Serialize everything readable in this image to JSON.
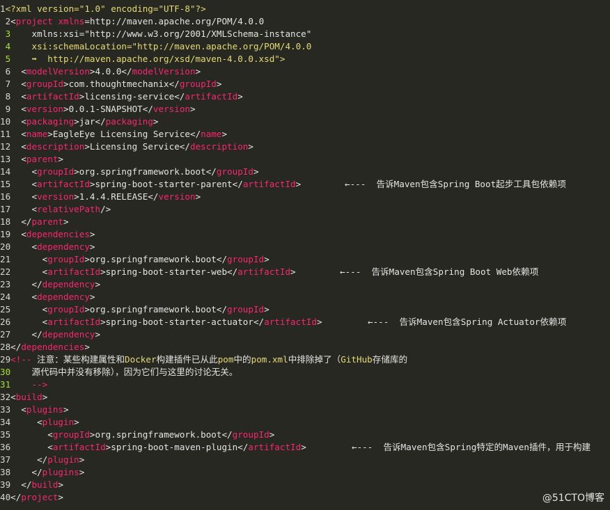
{
  "colors": {
    "background": "#272822",
    "text": "#e4e4e4",
    "tag": "#f92672",
    "string": "#e6db74",
    "attribute": "#a6e22e",
    "comment": "#f92672",
    "line_number_highlight": "#a6e22e"
  },
  "code": {
    "lines": [
      {
        "n": "1",
        "tokens": [
          {
            "t": "<?xml version=\"1.0\" encoding=\"UTF-8\"?>",
            "c": "string"
          }
        ]
      },
      {
        "n": " 2",
        "tokens": [
          {
            "t": "<",
            "c": "text"
          },
          {
            "t": "project",
            "c": "tag"
          },
          {
            "t": " ",
            "c": "text"
          },
          {
            "t": "xmlns",
            "c": "tag"
          },
          {
            "t": "=http://maven.apache.org/POM/4.0.0",
            "c": "text"
          }
        ]
      },
      {
        "n": " 3",
        "hl": true,
        "tokens": [
          {
            "t": "    xmlns:xsi=\"http://www.w3.org/2001/XMLSchema-instance\"",
            "c": "text"
          }
        ]
      },
      {
        "n": " 4",
        "hl": true,
        "tokens": [
          {
            "t": "    xsi:schemaLocation=\"http://maven.apache.org/POM/4.0.0",
            "c": "string"
          }
        ]
      },
      {
        "n": " 5",
        "hl": true,
        "tokens": [
          {
            "t": "    ➡  http://maven.apache.org/xsd/maven-4.0.0.xsd\">",
            "c": "string"
          }
        ]
      },
      {
        "n": " 6",
        "tokens": [
          {
            "t": "  <",
            "c": "text"
          },
          {
            "t": "modelVersion",
            "c": "tag"
          },
          {
            "t": ">4.0.0</",
            "c": "text"
          },
          {
            "t": "modelVersion",
            "c": "tag"
          },
          {
            "t": ">",
            "c": "text"
          }
        ]
      },
      {
        "n": " 7",
        "tokens": [
          {
            "t": "  <",
            "c": "text"
          },
          {
            "t": "groupId",
            "c": "tag"
          },
          {
            "t": ">com.thoughtmechanix</",
            "c": "text"
          },
          {
            "t": "groupId",
            "c": "tag"
          },
          {
            "t": ">",
            "c": "text"
          }
        ]
      },
      {
        "n": " 8",
        "tokens": [
          {
            "t": "  <",
            "c": "text"
          },
          {
            "t": "artifactId",
            "c": "tag"
          },
          {
            "t": ">licensing-service</",
            "c": "text"
          },
          {
            "t": "artifactId",
            "c": "tag"
          },
          {
            "t": ">",
            "c": "text"
          }
        ]
      },
      {
        "n": " 9",
        "tokens": [
          {
            "t": "  <",
            "c": "text"
          },
          {
            "t": "version",
            "c": "tag"
          },
          {
            "t": ">0.0.1-SNAPSHOT</",
            "c": "text"
          },
          {
            "t": "version",
            "c": "tag"
          },
          {
            "t": ">",
            "c": "text"
          }
        ]
      },
      {
        "n": "10",
        "tokens": [
          {
            "t": "  <",
            "c": "text"
          },
          {
            "t": "packaging",
            "c": "tag"
          },
          {
            "t": ">jar</",
            "c": "text"
          },
          {
            "t": "packaging",
            "c": "tag"
          },
          {
            "t": ">",
            "c": "text"
          }
        ]
      },
      {
        "n": "11",
        "tokens": [
          {
            "t": "  <",
            "c": "text"
          },
          {
            "t": "name",
            "c": "tag"
          },
          {
            "t": ">EagleEye Licensing Service</",
            "c": "text"
          },
          {
            "t": "name",
            "c": "tag"
          },
          {
            "t": ">",
            "c": "text"
          }
        ]
      },
      {
        "n": "12",
        "tokens": [
          {
            "t": "  <",
            "c": "text"
          },
          {
            "t": "description",
            "c": "tag"
          },
          {
            "t": ">Licensing Service</",
            "c": "text"
          },
          {
            "t": "description",
            "c": "tag"
          },
          {
            "t": ">",
            "c": "text"
          }
        ]
      },
      {
        "n": "13",
        "tokens": [
          {
            "t": "  <",
            "c": "text"
          },
          {
            "t": "parent",
            "c": "tag"
          },
          {
            "t": ">",
            "c": "text"
          }
        ]
      },
      {
        "n": "14",
        "tokens": [
          {
            "t": "    <",
            "c": "text"
          },
          {
            "t": "groupId",
            "c": "tag"
          },
          {
            "t": ">org.springframework.boot</",
            "c": "text"
          },
          {
            "t": "groupId",
            "c": "tag"
          },
          {
            "t": ">",
            "c": "text"
          }
        ]
      },
      {
        "n": "15",
        "tokens": [
          {
            "t": "    <",
            "c": "text"
          },
          {
            "t": "artifactId",
            "c": "tag"
          },
          {
            "t": ">spring-boot-starter-parent</",
            "c": "text"
          },
          {
            "t": "artifactId",
            "c": "tag"
          },
          {
            "t": ">",
            "c": "text"
          }
        ],
        "annotation": "←---  告诉Maven包含Spring Boot起步工具包依赖项"
      },
      {
        "n": "16",
        "tokens": [
          {
            "t": "    <",
            "c": "text"
          },
          {
            "t": "version",
            "c": "tag"
          },
          {
            "t": ">1.4.4.RELEASE</",
            "c": "text"
          },
          {
            "t": "version",
            "c": "tag"
          },
          {
            "t": ">",
            "c": "text"
          }
        ]
      },
      {
        "n": "17",
        "tokens": [
          {
            "t": "    <",
            "c": "text"
          },
          {
            "t": "relativePath",
            "c": "tag"
          },
          {
            "t": "/>",
            "c": "text"
          }
        ]
      },
      {
        "n": "18",
        "tokens": [
          {
            "t": "  </",
            "c": "text"
          },
          {
            "t": "parent",
            "c": "tag"
          },
          {
            "t": ">",
            "c": "text"
          }
        ]
      },
      {
        "n": "19",
        "tokens": [
          {
            "t": "  <",
            "c": "text"
          },
          {
            "t": "dependencies",
            "c": "tag"
          },
          {
            "t": ">",
            "c": "text"
          }
        ]
      },
      {
        "n": "20",
        "tokens": [
          {
            "t": "    <",
            "c": "text"
          },
          {
            "t": "dependency",
            "c": "tag"
          },
          {
            "t": ">",
            "c": "text"
          }
        ]
      },
      {
        "n": "21",
        "tokens": [
          {
            "t": "      <",
            "c": "text"
          },
          {
            "t": "groupId",
            "c": "tag"
          },
          {
            "t": ">org.springframework.boot</",
            "c": "text"
          },
          {
            "t": "groupId",
            "c": "tag"
          },
          {
            "t": ">",
            "c": "text"
          }
        ]
      },
      {
        "n": "22",
        "tokens": [
          {
            "t": "      <",
            "c": "text"
          },
          {
            "t": "artifactId",
            "c": "tag"
          },
          {
            "t": ">spring-boot-starter-web</",
            "c": "text"
          },
          {
            "t": "artifactId",
            "c": "tag"
          },
          {
            "t": ">",
            "c": "text"
          }
        ],
        "annotation": "←---  告诉Maven包含Spring Boot Web依赖项"
      },
      {
        "n": "23",
        "tokens": [
          {
            "t": "    </",
            "c": "text"
          },
          {
            "t": "dependency",
            "c": "tag"
          },
          {
            "t": ">",
            "c": "text"
          }
        ]
      },
      {
        "n": "24",
        "tokens": [
          {
            "t": "    <",
            "c": "text"
          },
          {
            "t": "dependency",
            "c": "tag"
          },
          {
            "t": ">",
            "c": "text"
          }
        ]
      },
      {
        "n": "25",
        "tokens": [
          {
            "t": "      <",
            "c": "text"
          },
          {
            "t": "groupId",
            "c": "tag"
          },
          {
            "t": ">org.springframework.boot</",
            "c": "text"
          },
          {
            "t": "groupId",
            "c": "tag"
          },
          {
            "t": ">",
            "c": "text"
          }
        ]
      },
      {
        "n": "26",
        "tokens": [
          {
            "t": "      <",
            "c": "text"
          },
          {
            "t": "artifactId",
            "c": "tag"
          },
          {
            "t": ">spring-boot-starter-actuator</",
            "c": "text"
          },
          {
            "t": "artifactId",
            "c": "tag"
          },
          {
            "t": ">",
            "c": "text"
          }
        ],
        "annotation": "←---  告诉Maven包含Spring Actuator依赖项"
      },
      {
        "n": "27",
        "tokens": [
          {
            "t": "    </",
            "c": "text"
          },
          {
            "t": "dependency",
            "c": "tag"
          },
          {
            "t": ">",
            "c": "text"
          }
        ]
      },
      {
        "n": "28",
        "tokens": [
          {
            "t": "</",
            "c": "text"
          },
          {
            "t": "dependencies",
            "c": "tag"
          },
          {
            "t": ">",
            "c": "text"
          }
        ]
      },
      {
        "n": "29",
        "tokens": [
          {
            "t": "<!-- ",
            "c": "tag"
          },
          {
            "t": "注意：某些构建属性和",
            "c": "text"
          },
          {
            "t": "Docker",
            "c": "string"
          },
          {
            "t": "构建插件已从此",
            "c": "text"
          },
          {
            "t": "pom",
            "c": "string"
          },
          {
            "t": "中的",
            "c": "text"
          },
          {
            "t": "pom.xml",
            "c": "string"
          },
          {
            "t": "中排除掉了（",
            "c": "text"
          },
          {
            "t": "GitHub",
            "c": "string"
          },
          {
            "t": "存储库的",
            "c": "text"
          }
        ]
      },
      {
        "n": "30",
        "hl": true,
        "tokens": [
          {
            "t": "    源代码中并没有移除），因为它们与这里的讨论无关。",
            "c": "text"
          }
        ]
      },
      {
        "n": "31",
        "hl": true,
        "tokens": [
          {
            "t": "    -->",
            "c": "tag"
          }
        ]
      },
      {
        "n": "32",
        "tokens": [
          {
            "t": "<",
            "c": "text"
          },
          {
            "t": "build",
            "c": "tag"
          },
          {
            "t": ">",
            "c": "text"
          }
        ]
      },
      {
        "n": "33",
        "tokens": [
          {
            "t": "  <",
            "c": "text"
          },
          {
            "t": "plugins",
            "c": "tag"
          },
          {
            "t": ">",
            "c": "text"
          }
        ]
      },
      {
        "n": "34",
        "tokens": [
          {
            "t": "     <",
            "c": "text"
          },
          {
            "t": "plugin",
            "c": "tag"
          },
          {
            "t": ">",
            "c": "text"
          }
        ]
      },
      {
        "n": "35",
        "tokens": [
          {
            "t": "       <",
            "c": "text"
          },
          {
            "t": "groupId",
            "c": "tag"
          },
          {
            "t": ">org.springframework.boot</",
            "c": "text"
          },
          {
            "t": "groupId",
            "c": "tag"
          },
          {
            "t": ">",
            "c": "text"
          }
        ]
      },
      {
        "n": "36",
        "tokens": [
          {
            "t": "       <",
            "c": "text"
          },
          {
            "t": "artifactId",
            "c": "tag"
          },
          {
            "t": ">spring-boot-maven-plugin</",
            "c": "text"
          },
          {
            "t": "artifactId",
            "c": "tag"
          },
          {
            "t": ">",
            "c": "text"
          }
        ],
        "annotation": "←---  告诉Maven包含Spring特定的Maven插件，用于构建"
      },
      {
        "n": "37",
        "tokens": [
          {
            "t": "     </",
            "c": "text"
          },
          {
            "t": "plugin",
            "c": "tag"
          },
          {
            "t": ">",
            "c": "text"
          }
        ]
      },
      {
        "n": "38",
        "tokens": [
          {
            "t": "    </",
            "c": "text"
          },
          {
            "t": "plugins",
            "c": "tag"
          },
          {
            "t": ">",
            "c": "text"
          }
        ]
      },
      {
        "n": "39",
        "tokens": [
          {
            "t": "  </",
            "c": "text"
          },
          {
            "t": "build",
            "c": "tag"
          },
          {
            "t": ">",
            "c": "text"
          }
        ]
      },
      {
        "n": "40",
        "tokens": [
          {
            "t": "</",
            "c": "text"
          },
          {
            "t": "project",
            "c": "tag"
          },
          {
            "t": ">",
            "c": "text"
          }
        ]
      }
    ]
  },
  "watermark": "@51CTO博客"
}
